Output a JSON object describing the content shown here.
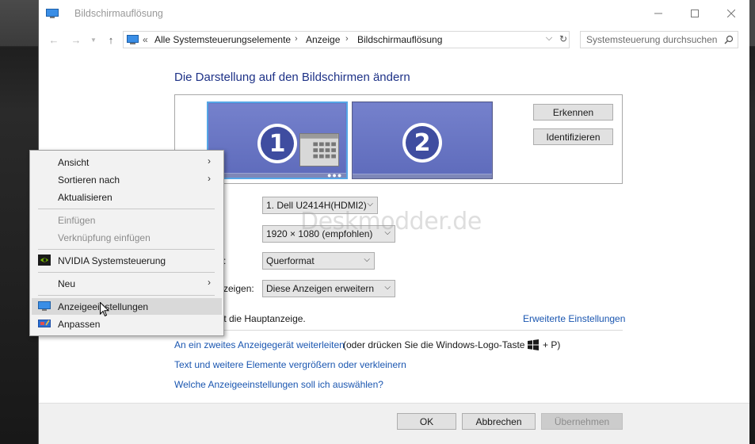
{
  "window": {
    "title": "Bildschirmauflösung"
  },
  "nav": {
    "breadcrumb_prefix": "«",
    "crumbs": [
      "Alle Systemsteuerungselemente",
      "Anzeige",
      "Bildschirmauflösung"
    ],
    "search_placeholder": "Systemsteuerung durchsuchen"
  },
  "content": {
    "heading": "Die Darstellung auf den Bildschirmen ändern",
    "monitors": [
      {
        "label": "1"
      },
      {
        "label": "2"
      }
    ],
    "detect_label": "Erkennen",
    "identify_label": "Identifizieren",
    "orientation_label_partial": ":",
    "multi_label_partial": "zeigen:",
    "display_value": "1. Dell U2414H(HDMI2)",
    "resolution_value": "1920 × 1080 (empfohlen)",
    "orientation_value": "Querformat",
    "multi_value": "Diese Anzeigen erweitern",
    "main_display_partial": "eit die Hauptanzeige.",
    "advanced_link": "Erweiterte Einstellungen",
    "project_link": "An ein zweites Anzeigegerät weiterleiten",
    "project_rest": "(oder drücken Sie die Windows-Logo-Taste",
    "project_key": "+ P)",
    "textsize_link": "Text und weitere Elemente vergrößern oder verkleinern",
    "which_link": "Welche Anzeigeeinstellungen soll ich auswählen?"
  },
  "watermark": "Deskmodder.de",
  "buttons": {
    "ok": "OK",
    "cancel": "Abbrechen",
    "apply": "Übernehmen"
  },
  "context_menu": {
    "items": [
      {
        "label": "Ansicht"
      },
      {
        "label": "Sortieren nach"
      },
      {
        "label": "Aktualisieren"
      },
      {
        "label": "Einfügen"
      },
      {
        "label": "Verknüpfung einfügen"
      },
      {
        "label": "NVIDIA Systemsteuerung"
      },
      {
        "label": "Neu"
      },
      {
        "label": "Anzeigeeinstellungen"
      },
      {
        "label": "Anpassen"
      }
    ]
  },
  "colors": {
    "heading": "#1e3287",
    "link": "#1a56b0",
    "monitor_fill": "#6a77c4",
    "monitor_selected_border": "#55a6e6",
    "nvidia_green": "#76b900"
  },
  "icons": {
    "window": "monitor-icon",
    "address": "control-panel-icon",
    "search": "magnifier-icon",
    "nvidia": "nvidia-icon",
    "display_settings": "display-settings-icon",
    "personalize": "personalize-icon"
  }
}
